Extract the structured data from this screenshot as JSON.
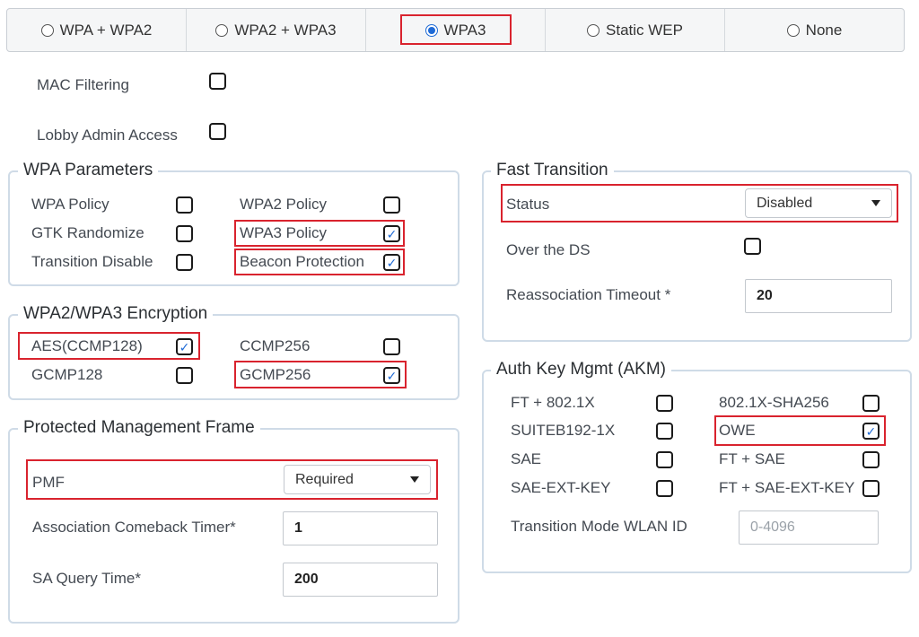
{
  "security_tabs": [
    {
      "label": "WPA + WPA2",
      "selected": false
    },
    {
      "label": "WPA2 + WPA3",
      "selected": false
    },
    {
      "label": "WPA3",
      "selected": true
    },
    {
      "label": "Static WEP",
      "selected": false
    },
    {
      "label": "None",
      "selected": false
    }
  ],
  "top_options": {
    "mac_filtering": {
      "label": "MAC Filtering",
      "checked": false
    },
    "lobby_admin_access": {
      "label": "Lobby Admin Access",
      "checked": false
    }
  },
  "wpa_parameters": {
    "legend": "WPA Parameters",
    "wpa_policy": {
      "label": "WPA Policy",
      "checked": false
    },
    "wpa2_policy": {
      "label": "WPA2 Policy",
      "checked": false
    },
    "gtk_randomize": {
      "label": "GTK Randomize",
      "checked": false
    },
    "wpa3_policy": {
      "label": "WPA3 Policy",
      "checked": true
    },
    "transition_disable": {
      "label": "Transition Disable",
      "checked": false
    },
    "beacon_protection": {
      "label": "Beacon Protection",
      "checked": true
    }
  },
  "encryption": {
    "legend": "WPA2/WPA3 Encryption",
    "aes_ccmp128": {
      "label": "AES(CCMP128)",
      "checked": true
    },
    "ccmp256": {
      "label": "CCMP256",
      "checked": false
    },
    "gcmp128": {
      "label": "GCMP128",
      "checked": false
    },
    "gcmp256": {
      "label": "GCMP256",
      "checked": true
    }
  },
  "pmf": {
    "legend": "Protected Management Frame",
    "pmf_label": "PMF",
    "pmf_value": "Required",
    "comeback_label": "Association Comeback Timer*",
    "comeback_value": "1",
    "sa_query_label": "SA Query Time*",
    "sa_query_value": "200"
  },
  "fast_transition": {
    "legend": "Fast Transition",
    "status_label": "Status",
    "status_value": "Disabled",
    "over_ds": {
      "label": "Over the DS",
      "checked": false
    },
    "reassoc_label": "Reassociation Timeout *",
    "reassoc_value": "20"
  },
  "akm": {
    "legend": "Auth Key Mgmt (AKM)",
    "ft_8021x": {
      "label": "FT + 802.1X",
      "checked": false
    },
    "x_sha256": {
      "label": "802.1X-SHA256",
      "checked": false
    },
    "suiteb": {
      "label": "SUITEB192-1X",
      "checked": false
    },
    "owe": {
      "label": "OWE",
      "checked": true
    },
    "sae": {
      "label": "SAE",
      "checked": false
    },
    "ft_sae": {
      "label": "FT + SAE",
      "checked": false
    },
    "sae_ext": {
      "label": "SAE-EXT-KEY",
      "checked": false
    },
    "ft_sae_ext": {
      "label": "FT + SAE-EXT-KEY",
      "checked": false
    },
    "transition_label": "Transition Mode WLAN ID",
    "transition_placeholder": "0-4096"
  },
  "colors": {
    "highlight": "#d9232e",
    "accent": "#1f6bd6",
    "fieldset_border": "#cfdbe7"
  }
}
